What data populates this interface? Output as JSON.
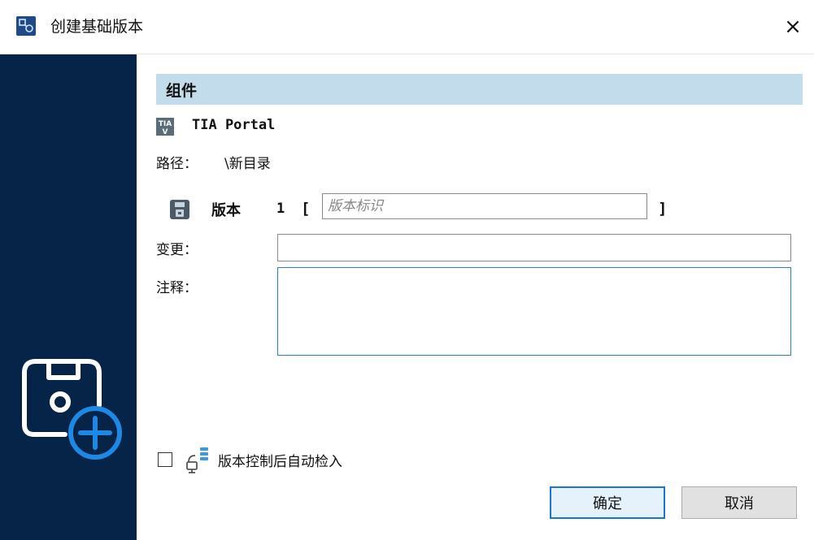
{
  "window": {
    "title": "创建基础版本",
    "close_label": "×"
  },
  "section": {
    "heading": "组件"
  },
  "component": {
    "name": "TIA Portal",
    "icon": "tia-portal-icon",
    "icon_text_top": "TIA",
    "icon_text_bottom": "V"
  },
  "path": {
    "label": "路径：",
    "value": "\\新目录"
  },
  "version": {
    "label": "版本",
    "number": "1",
    "open_bracket": "[",
    "close_bracket": "]",
    "placeholder": "版本标识",
    "value": ""
  },
  "change": {
    "label": "变更：",
    "value": ""
  },
  "comment": {
    "label": "注释：",
    "value": ""
  },
  "auto_checkin": {
    "label": "版本控制后自动检入",
    "checked": false
  },
  "buttons": {
    "ok": "确定",
    "cancel": "取消"
  },
  "colors": {
    "sidebar": "#062447",
    "section_header": "#c3dcec",
    "accent": "#1a73d6",
    "plus_circle": "#1e88e5"
  }
}
